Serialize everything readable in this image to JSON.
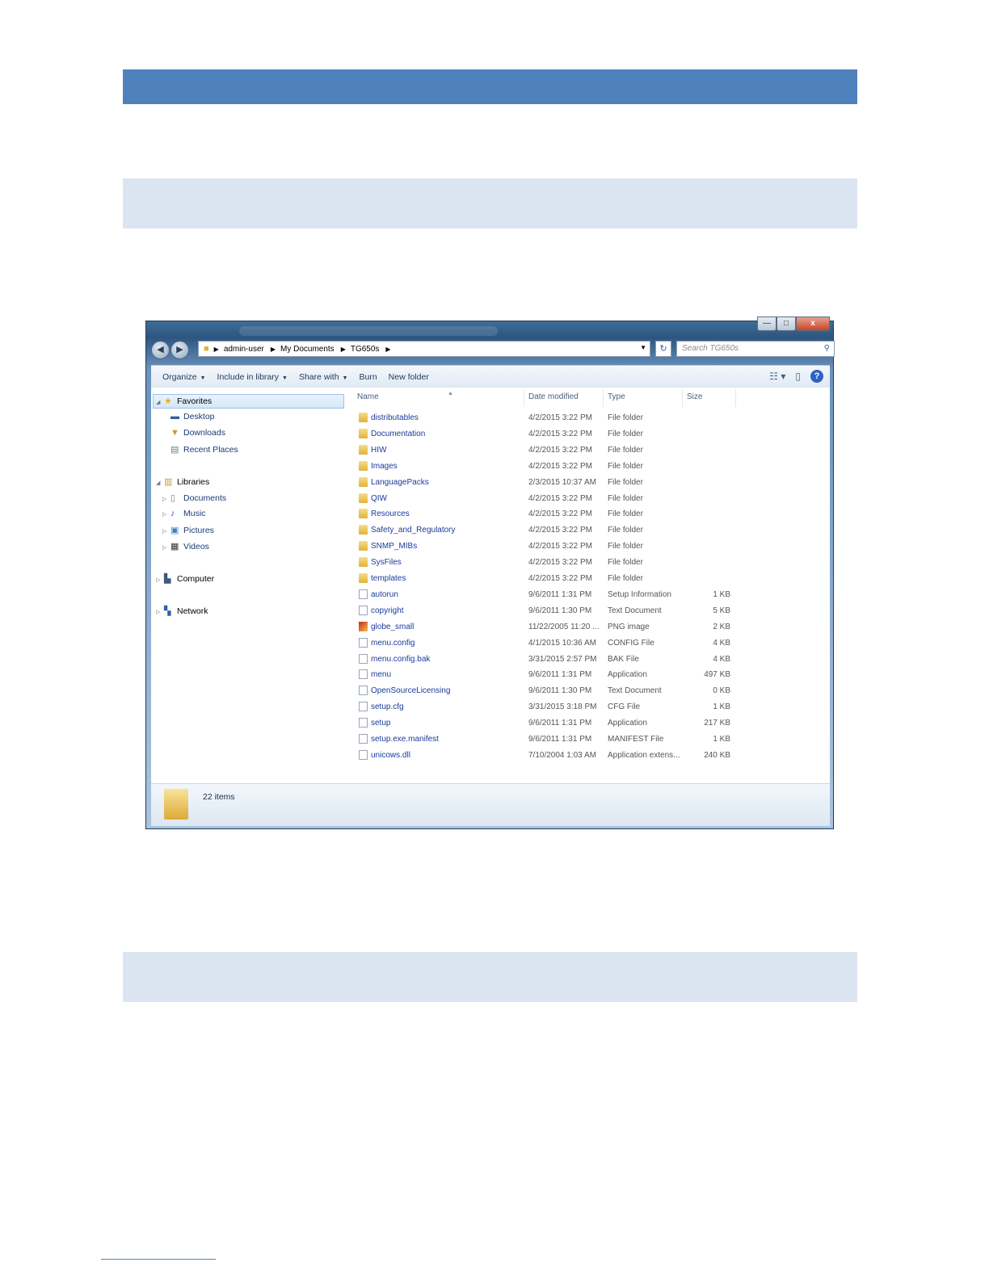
{
  "window": {
    "caption": {
      "minimize": "—",
      "maximize": "□",
      "close": "x"
    }
  },
  "address": {
    "crumbs": [
      "admin-user",
      "My Documents",
      "TG650s"
    ],
    "search_placeholder": "Search TG650s"
  },
  "toolbar": {
    "organize": "Organize",
    "include_in_library": "Include in library",
    "share_with": "Share with",
    "burn": "Burn",
    "new_folder": "New folder",
    "help": "?"
  },
  "nav": {
    "favorites": "Favorites",
    "desktop": "Desktop",
    "downloads": "Downloads",
    "recent_places": "Recent Places",
    "libraries": "Libraries",
    "documents": "Documents",
    "music": "Music",
    "pictures": "Pictures",
    "videos": "Videos",
    "computer": "Computer",
    "network": "Network"
  },
  "columns": {
    "name": "Name",
    "date": "Date modified",
    "type": "Type",
    "size": "Size"
  },
  "files": [
    {
      "name": "distributables",
      "date": "4/2/2015 3:22 PM",
      "type": "File folder",
      "size": "",
      "kind": "folder"
    },
    {
      "name": "Documentation",
      "date": "4/2/2015 3:22 PM",
      "type": "File folder",
      "size": "",
      "kind": "folder"
    },
    {
      "name": "HIW",
      "date": "4/2/2015 3:22 PM",
      "type": "File folder",
      "size": "",
      "kind": "folder"
    },
    {
      "name": "Images",
      "date": "4/2/2015 3:22 PM",
      "type": "File folder",
      "size": "",
      "kind": "folder"
    },
    {
      "name": "LanguagePacks",
      "date": "2/3/2015 10:37 AM",
      "type": "File folder",
      "size": "",
      "kind": "folder"
    },
    {
      "name": "QIW",
      "date": "4/2/2015 3:22 PM",
      "type": "File folder",
      "size": "",
      "kind": "folder"
    },
    {
      "name": "Resources",
      "date": "4/2/2015 3:22 PM",
      "type": "File folder",
      "size": "",
      "kind": "folder"
    },
    {
      "name": "Safety_and_Regulatory",
      "date": "4/2/2015 3:22 PM",
      "type": "File folder",
      "size": "",
      "kind": "folder"
    },
    {
      "name": "SNMP_MIBs",
      "date": "4/2/2015 3:22 PM",
      "type": "File folder",
      "size": "",
      "kind": "folder"
    },
    {
      "name": "SysFiles",
      "date": "4/2/2015 3:22 PM",
      "type": "File folder",
      "size": "",
      "kind": "folder"
    },
    {
      "name": "templates",
      "date": "4/2/2015 3:22 PM",
      "type": "File folder",
      "size": "",
      "kind": "folder"
    },
    {
      "name": "autorun",
      "date": "9/6/2011 1:31 PM",
      "type": "Setup Information",
      "size": "1 KB",
      "kind": "doc"
    },
    {
      "name": "copyright",
      "date": "9/6/2011 1:30 PM",
      "type": "Text Document",
      "size": "5 KB",
      "kind": "doc"
    },
    {
      "name": "globe_small",
      "date": "11/22/2005 11:20 ...",
      "type": "PNG image",
      "size": "2 KB",
      "kind": "png"
    },
    {
      "name": "menu.config",
      "date": "4/1/2015 10:36 AM",
      "type": "CONFIG File",
      "size": "4 KB",
      "kind": "doc"
    },
    {
      "name": "menu.config.bak",
      "date": "3/31/2015 2:57 PM",
      "type": "BAK File",
      "size": "4 KB",
      "kind": "doc"
    },
    {
      "name": "menu",
      "date": "9/6/2011 1:31 PM",
      "type": "Application",
      "size": "497 KB",
      "kind": "app"
    },
    {
      "name": "OpenSourceLicensing",
      "date": "9/6/2011 1:30 PM",
      "type": "Text Document",
      "size": "0 KB",
      "kind": "doc"
    },
    {
      "name": "setup.cfg",
      "date": "3/31/2015 3:18 PM",
      "type": "CFG File",
      "size": "1 KB",
      "kind": "doc"
    },
    {
      "name": "setup",
      "date": "9/6/2011 1:31 PM",
      "type": "Application",
      "size": "217 KB",
      "kind": "app"
    },
    {
      "name": "setup.exe.manifest",
      "date": "9/6/2011 1:31 PM",
      "type": "MANIFEST File",
      "size": "1 KB",
      "kind": "doc"
    },
    {
      "name": "unicows.dll",
      "date": "7/10/2004 1:03 AM",
      "type": "Application extens...",
      "size": "240 KB",
      "kind": "doc"
    }
  ],
  "status": {
    "count": "22 items"
  }
}
